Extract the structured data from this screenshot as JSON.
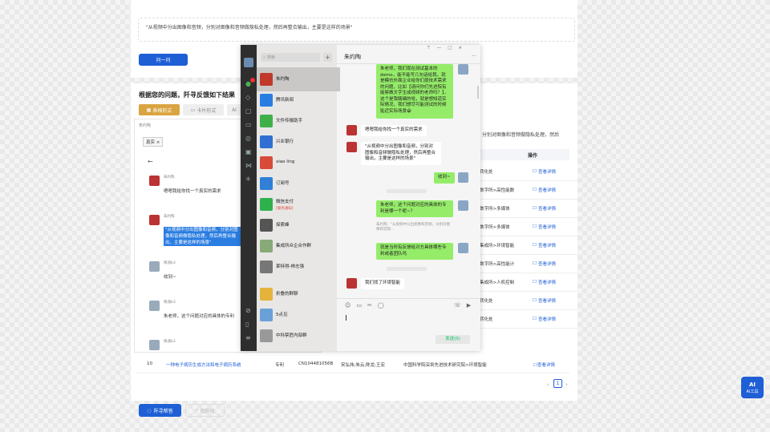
{
  "top": {
    "query": "\"从视频中分出图像和音频，分别对图像和音频做隐私处理，然后再整合输出，主要是这样的场景\"",
    "ask_button": "问一问"
  },
  "results": {
    "title": "根据您的问题，阡寻反馈如下结果",
    "view_buttons": [
      "表格形式",
      "卡片形式",
      "AI"
    ],
    "query_snippet": "分别对图像和音频做隐私处理，然后",
    "col_action": "操作",
    "rows": [
      {
        "unit": "转化处",
        "action": "查看详情"
      },
      {
        "unit": "数字所>高性能数",
        "action": "查看详情"
      },
      {
        "unit": "数字所>多媒体",
        "action": "查看详情"
      },
      {
        "unit": "数字所>多媒体",
        "action": "查看详情"
      },
      {
        "unit": "集成所>环境智能",
        "action": "查看详情"
      },
      {
        "unit": "数字所>高性能计",
        "action": "查看详情"
      },
      {
        "unit": "集成所>人机控制",
        "action": "查看详情"
      },
      {
        "unit": "转化处",
        "action": "查看详情"
      },
      {
        "unit": "转化处",
        "action": "查看详情"
      }
    ],
    "last_row": {
      "index": "10",
      "title": "一种电子病历生成方法和电子病历系统",
      "type": "专利",
      "number": "CN104481056B",
      "inventors": "宋弘炜;朱云;陈龙;王宏",
      "org": "中国科学院深圳先进技术研究院>环境智能",
      "action": "查看详情"
    },
    "page": "1"
  },
  "bottom_buttons": {
    "primary": "阡寻帮答",
    "secondary": "我想找"
  },
  "ai_tool": {
    "badge": "AI",
    "label": "AI工具"
  },
  "underlay_chat": {
    "header": "朱约陶",
    "tag": "真实",
    "messages": [
      {
        "name": "朱约陶",
        "text": "嗯嗯我给你找一个真实的需求"
      },
      {
        "name": "朱约陶",
        "text": "\"从视频中分出图像和音频，分别对图像和音频做隐私处理，然后再整合输出，主要是这样的场景\""
      },
      {
        "name": "佩涵b3",
        "text": "收到~"
      },
      {
        "name": "佩涵b3",
        "text": "朱老师，这个问题对应的具体的专利"
      },
      {
        "name": "佩涵b3",
        "text": ""
      }
    ]
  },
  "wechat": {
    "search_placeholder": "搜索",
    "contacts": [
      {
        "name": "朱约陶",
        "preview": "",
        "time": "",
        "color": "#c0392b"
      },
      {
        "name": "腾讯新闻",
        "preview": "",
        "time": "",
        "color": "#2a7de1"
      },
      {
        "name": "文件传输助手",
        "preview": "",
        "time": "",
        "color": "#3fb047"
      },
      {
        "name": "兴业银行",
        "preview": "",
        "time": "",
        "color": "#2f6fd1"
      },
      {
        "name": "xiao ling",
        "preview": "",
        "time": "",
        "color": "#d84b3a"
      },
      {
        "name": "订阅号",
        "preview": "",
        "time": "",
        "color": "#2f80d6"
      },
      {
        "name": "微信支付",
        "preview": "[服务通知]",
        "time": "",
        "color": "#2fb24c"
      },
      {
        "name": "探索峰",
        "preview": "",
        "time": "",
        "color": "#555"
      },
      {
        "name": "集成所众企合作群",
        "preview": "",
        "time": "",
        "color": "#8a7"
      },
      {
        "name": "莱特得-林志强",
        "preview": "",
        "time": "",
        "color": "#777"
      },
      {
        "name": "折叠的群聊",
        "preview": "",
        "time": "",
        "color": "#e3b33c"
      },
      {
        "name": "5点见",
        "preview": "",
        "time": "",
        "color": "#6aa0d8"
      },
      {
        "name": "中科禁匠内部群",
        "preview": "",
        "time": "",
        "color": "#999"
      }
    ],
    "chat_title": "朱约陶",
    "msgs": {
      "m1": "朱老师，我们现在测试基本的demo，能不能写几句话给我，就是模仿外面企业给你们提技术需求的问题，比如【请问你们先进院有能够做文字生成视频的老师吗？】，这个是我瞎编的哈，就是想知道实际情况，我们想尽可能测试的时候贴近实际场景😁",
      "m2": "嗯嗯我给你找一个真实的需求",
      "m3": "\"从视频中分出图像和音频，分别对图像和音频做隐私处理，然后再整合输出，主要是这样的场景\"",
      "m4": "收到~",
      "m5": "朱老师，这个问题对应的具体的专利是哪一个呢~？",
      "m6": "朱约陶：\"从视频中分出图像和音频，分别对图像和音频...",
      "m7": "就是当时有反馈给对方具体哪些专利或者团队吗",
      "m8": "我们找了环境智能"
    },
    "send_button": "发送(S)"
  }
}
